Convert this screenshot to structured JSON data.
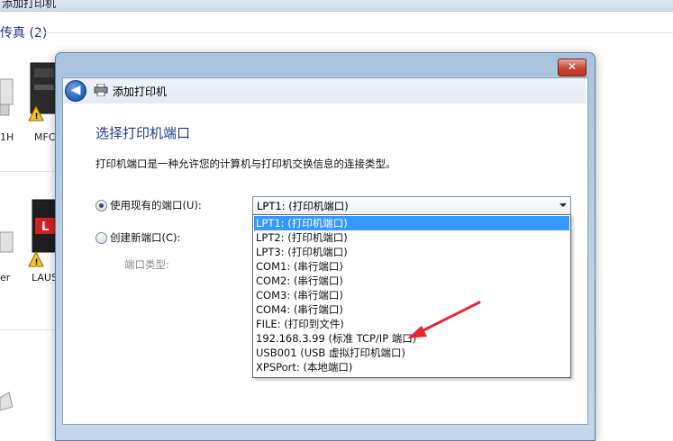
{
  "background": {
    "window_title": "添加打印机",
    "section_title": "传真 (2)",
    "devices": [
      {
        "label": "1H"
      },
      {
        "label": "MFC"
      },
      {
        "label": "er"
      },
      {
        "label": "LAUS"
      }
    ]
  },
  "dialog": {
    "title": "添加打印机",
    "close_label": "✕",
    "back_label": "◀",
    "heading": "选择打印机端口",
    "description": "打印机端口是一种允许您的计算机与打印机交换信息的连接类型。",
    "use_existing_label": "使用现有的端口(U):",
    "create_new_label": "创建新端口(C):",
    "port_type_label": "端口类型:",
    "selected_port": "LPT1: (打印机端口)",
    "port_options": [
      "LPT1: (打印机端口)",
      "LPT2: (打印机端口)",
      "LPT3: (打印机端口)",
      "COM1: (串行端口)",
      "COM2: (串行端口)",
      "COM3: (串行端口)",
      "COM4: (串行端口)",
      "FILE: (打印到文件)",
      "192.168.3.99 (标准 TCP/IP 端口)",
      "USB001 (USB 虚拟打印机端口)",
      "XPSPort: (本地端口)"
    ],
    "highlighted_option_index": 0
  },
  "colors": {
    "heading": "#1e3d8f",
    "selection": "#3399ff",
    "annotation_arrow": "#e8262b",
    "close_button": "#c74732"
  }
}
